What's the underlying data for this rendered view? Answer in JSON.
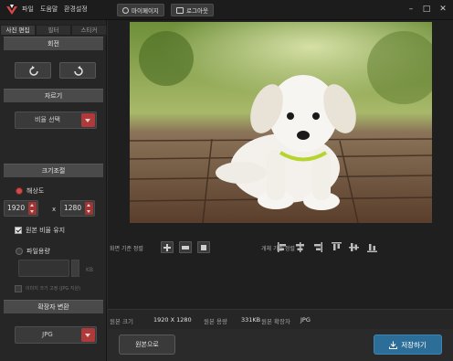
{
  "menu": [
    "파일",
    "도움말",
    "환경설정"
  ],
  "toolbar": {
    "mypage": "마이페이지",
    "logout": "로그아웃"
  },
  "tabs": [
    "사진 편집",
    "필터",
    "스티커"
  ],
  "sections": {
    "rotate": "회전",
    "crop": "자르기",
    "resize": "크기조절",
    "extension": "확장자 변환"
  },
  "crop": {
    "ratio_select": "비율 선택"
  },
  "resize": {
    "resolution_label": "해상도",
    "width": "1920",
    "height": "1280",
    "times": "x",
    "keep_ratio_label": "원본 비율 유지",
    "filesize_label": "파일용량",
    "unit_kb": "KB",
    "keep_image_size_label": "이미지 크기 고정 (JPG 지원)"
  },
  "extension": {
    "format": "JPG"
  },
  "align": {
    "canvas_label": "화면 기준 정렬",
    "object_label": "개체 기준 정렬"
  },
  "info": {
    "size_label": "원본 크기",
    "size_value": "1920 X 1280",
    "filesize_label": "원본 용량",
    "filesize_value": "331KB",
    "ext_label": "원본 확장자",
    "ext_value": "JPG"
  },
  "buttons": {
    "original": "원본으로",
    "save": "저장하기"
  },
  "colors": {
    "accent_red": "#b03a3a",
    "save_blue": "#2c6e98"
  }
}
